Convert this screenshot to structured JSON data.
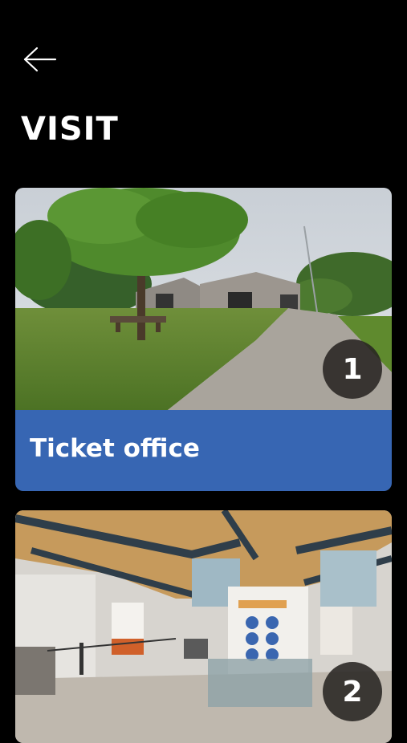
{
  "header": {
    "back_icon": "arrow-left-icon",
    "title": "VISIT"
  },
  "stops": [
    {
      "number": "1",
      "label": "Ticket office",
      "photo": "museum exterior with tree and picnic tables",
      "caption_color": "#3766b3"
    },
    {
      "number": "2",
      "label": "",
      "photo": "museum interior exhibition hall"
    }
  ]
}
